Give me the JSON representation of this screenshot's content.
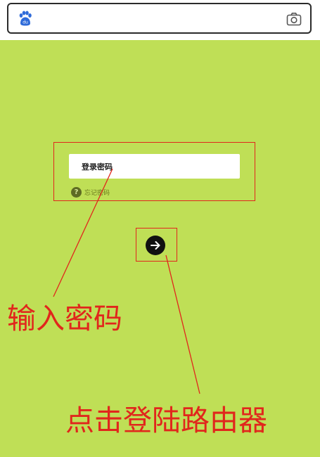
{
  "browser": {
    "search_value": "",
    "left_icon": "baidu-paw-icon",
    "right_icon": "camera-icon"
  },
  "login": {
    "password_placeholder": "登录密码",
    "forgot_password": "忘记密码",
    "help_icon_glyph": "?",
    "submit_icon": "arrow-right-icon"
  },
  "annotations": {
    "input_password": "输入密码",
    "click_login": "点击登陆路由器"
  },
  "colors": {
    "background": "#bfdf56",
    "annotation_red": "#e1261c",
    "button": "#111111"
  }
}
